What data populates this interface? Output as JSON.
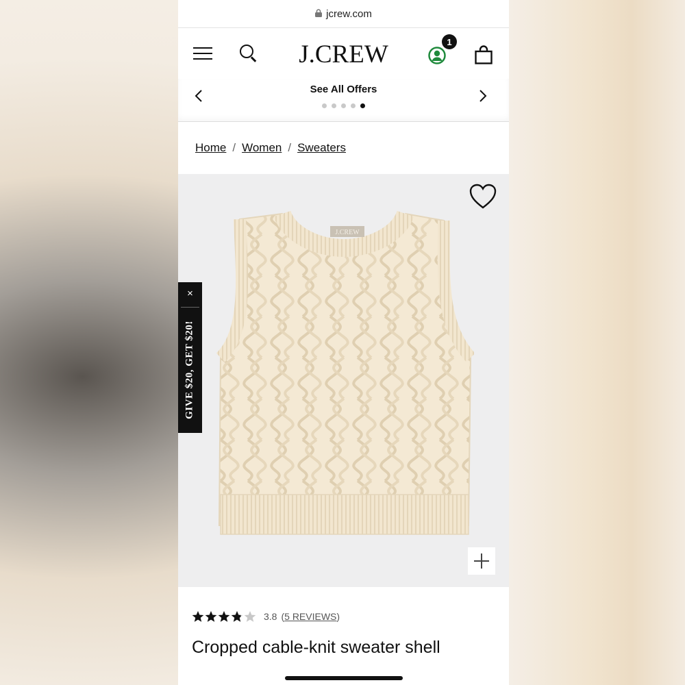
{
  "browser": {
    "url": "jcrew.com"
  },
  "header": {
    "logo": "J.CREW",
    "account_badge": "1"
  },
  "offers": {
    "title": "See All Offers",
    "dots": [
      false,
      false,
      false,
      false,
      true
    ]
  },
  "breadcrumb": [
    "Home",
    "Women",
    "Sweaters"
  ],
  "promo": {
    "close": "×",
    "text": "GIVE $20, GET $20!"
  },
  "product": {
    "rating": 3.8,
    "rating_text": "3.8",
    "reviews_link": "5 REVIEWS",
    "name": "Cropped cable-knit sweater shell",
    "image_label": "J.CREW"
  },
  "colors": {
    "accent_green": "#1f8a3c",
    "sweater": "#f2e6cf"
  }
}
